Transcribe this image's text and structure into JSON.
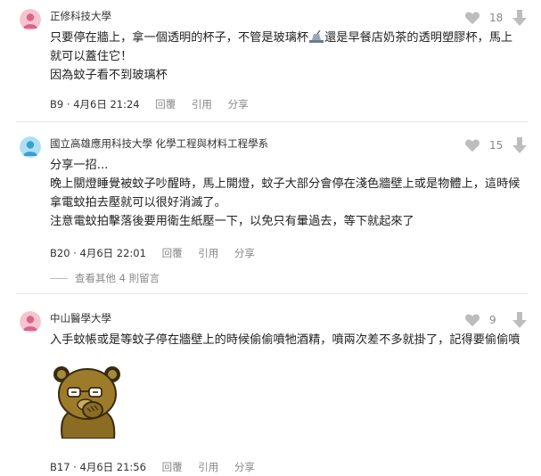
{
  "comments": [
    {
      "school": "正修科技大學",
      "likes": "18",
      "text_line1": "只要停在牆上，拿一個透明的杯子，不管是玻璃杯",
      "emoji_name": "cup-with-straw-emoji",
      "text_line1_rest": "還是早餐店奶茶的透明塑膠杯，馬上",
      "text_line2": "就可以蓋住它！",
      "text_line3": "因為蚊子看不到玻璃杯",
      "floor": "B9",
      "date": "4月6日 21:24",
      "reply": "回覆",
      "quote": "引用",
      "share": "分享",
      "avatar_color": "#f4b6c8"
    },
    {
      "school": "國立高雄應用科技大學 化學工程與材料工程學系",
      "likes": "15",
      "text_line1": "分享一招...",
      "text_line2": "晚上關燈睡覺被蚊子吵醒時，馬上開燈，蚊子大部分會停在淺色牆壁上或是物體上，這時候",
      "text_line3": "拿電蚊拍去壓就可以很好消滅了。",
      "text_line4": "注意電蚊拍擊落後要用衛生紙壓一下，以免只有暈過去，等下就起來了",
      "floor": "B20",
      "date": "4月6日 22:01",
      "reply": "回覆",
      "quote": "引用",
      "share": "分享",
      "avatar_color": "#8fd3f0"
    },
    {
      "school": "中山醫學大學",
      "likes": "9",
      "text_line1": "入手蚊帳或是等蚊子停在牆壁上的時候偷偷噴牠酒精，噴兩次差不多就掛了，記得要偷偷噴",
      "sticker_name": "bear-with-glasses-sticker",
      "floor": "B17",
      "date": "4月6日 21:56",
      "reply": "回覆",
      "quote": "引用",
      "share": "分享",
      "avatar_color": "#f4b6c8"
    }
  ],
  "more_replies": "查看其他 4 則留言",
  "colors": {
    "icon_gray": "#bdbdbd",
    "text": "#222222",
    "meta_gray": "#888888",
    "divider": "#e8e8e8"
  },
  "icons": {
    "like": "heart-icon",
    "dislike": "arrow-down-icon"
  }
}
